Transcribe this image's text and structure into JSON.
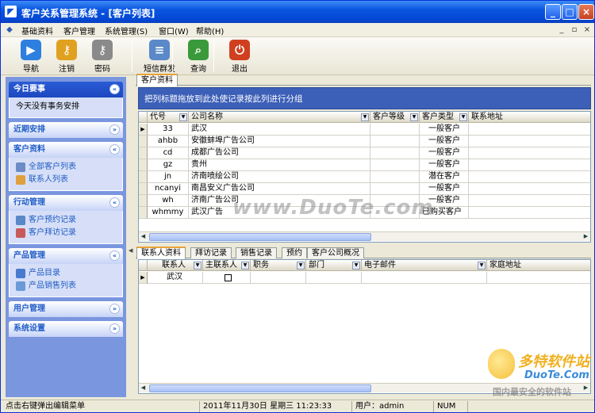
{
  "window": {
    "title": "客户关系管理系统 - [客户列表]",
    "min": "_",
    "max": "□",
    "close": "×"
  },
  "menu": [
    "基础资料",
    "客户管理",
    "系统管理(S)",
    "窗口(W)",
    "帮助(H)"
  ],
  "mdi_controls": {
    "min": "_",
    "restore": "▫",
    "close": "×"
  },
  "toolbar": [
    {
      "label": "导航",
      "icon": "navigate-icon",
      "glyph": "▶",
      "color": "#2d7fe0"
    },
    {
      "label": "注销",
      "icon": "logout-key-icon",
      "glyph": "⚷",
      "color": "#e0a020"
    },
    {
      "label": "密码",
      "icon": "password-key-icon",
      "glyph": "⚷",
      "color": "#8a8a8a"
    },
    {
      "label": "短信群发",
      "icon": "sms-icon",
      "glyph": "≡",
      "color": "#5a88c8"
    },
    {
      "label": "查询",
      "icon": "search-icon",
      "glyph": "⌕",
      "color": "#3a9a3a"
    },
    {
      "label": "退出",
      "icon": "exit-icon",
      "glyph": "⏻",
      "color": "#d04020"
    }
  ],
  "sidebar": [
    {
      "title": "今日要事",
      "dark": true,
      "chev": "«",
      "items": [
        {
          "label": "今天没有事务安排",
          "plain": true
        }
      ]
    },
    {
      "title": "近期安排",
      "chev": "»",
      "items": []
    },
    {
      "title": "客户资料",
      "chev": "«",
      "items": [
        {
          "label": "全部客户列表",
          "color": "#6b8cc7"
        },
        {
          "label": "联系人列表",
          "color": "#e0a040"
        }
      ]
    },
    {
      "title": "行动管理",
      "chev": "«",
      "items": [
        {
          "label": "客户预约记录",
          "color": "#5a88c8"
        },
        {
          "label": "客户拜访记录",
          "color": "#c85a5a"
        }
      ]
    },
    {
      "title": "产品管理",
      "chev": "«",
      "items": [
        {
          "label": "产品目录",
          "color": "#4a7ad0"
        },
        {
          "label": "产品销售列表",
          "color": "#6a9ad8"
        }
      ]
    },
    {
      "title": "用户管理",
      "chev": "»",
      "items": []
    },
    {
      "title": "系统设置",
      "chev": "»",
      "items": []
    }
  ],
  "doc_tab": "客户资料",
  "group_hint": "把列标题拖放到此处使记录按此列进行分组",
  "customer_grid": {
    "columns": [
      "代号",
      "公司名称",
      "客户等级",
      "客户类型",
      "联系地址"
    ],
    "rows": [
      [
        "33",
        "武汉",
        "",
        "一般客户",
        ""
      ],
      [
        "ahbb",
        "安徽蚌埠广告公司",
        "",
        "一般客户",
        ""
      ],
      [
        "cd",
        "成都广告公司",
        "",
        "一般客户",
        ""
      ],
      [
        "gz",
        "贵州",
        "",
        "一般客户",
        ""
      ],
      [
        "jn",
        "济南喷绘公司",
        "",
        "潜在客户",
        ""
      ],
      [
        "ncanyi",
        "南昌安义广告公司",
        "",
        "一般客户",
        ""
      ],
      [
        "wh",
        "济南广告公司",
        "",
        "一般客户",
        ""
      ],
      [
        "whmmy",
        "武汉广告",
        "",
        "已购买客户",
        ""
      ]
    ],
    "selected_marker": "▶"
  },
  "detail_tabs": [
    "联系人资料",
    "拜访记录",
    "销售记录",
    "预约",
    "客户公司概况"
  ],
  "contact_grid": {
    "columns": [
      "联系人",
      "主联系人",
      "职务",
      "部门",
      "电子邮件",
      "家庭地址"
    ],
    "rows": [
      [
        "武汉",
        "",
        "",
        "",
        "",
        ""
      ]
    ]
  },
  "statusbar": {
    "hint": "点击右键弹出编辑菜单",
    "datetime": "2011年11月30日 星期三 11:23:33",
    "user": "用户：admin",
    "num": "NUM"
  },
  "watermarks": {
    "center": "www.DuoTe.com",
    "logo_cn": "多特软件站",
    "logo_en": "DuoTe.Com",
    "logo_sub": "国内最安全的软件站"
  }
}
